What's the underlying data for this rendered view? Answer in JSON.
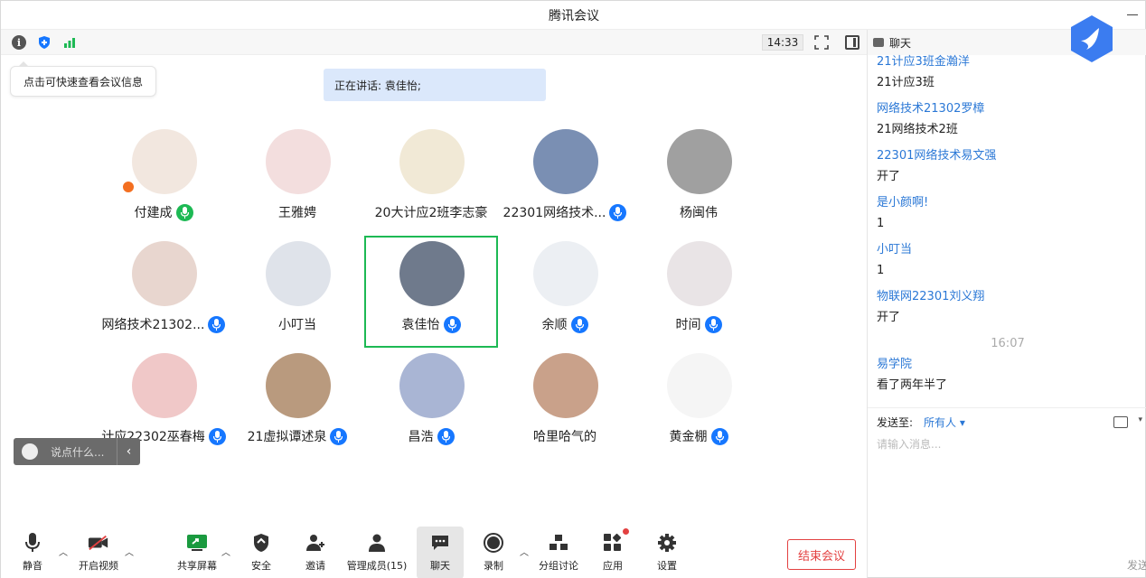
{
  "window": {
    "title": "腾讯会议"
  },
  "topbar": {
    "time": "14:33"
  },
  "tooltip": {
    "text": "点击可快速查看会议信息"
  },
  "speaking": {
    "text": "正在讲话: 袁佳怡;"
  },
  "participants": [
    {
      "name": "付建成",
      "mic": "green",
      "avatar_color": "#f2e7df"
    },
    {
      "name": "王雅娉",
      "mic": "none",
      "avatar_color": "#f3dede"
    },
    {
      "name": "20大计应2班李志豪",
      "mic": "none",
      "avatar_color": "#f1e9d6"
    },
    {
      "name": "22301网络技术...",
      "mic": "blue",
      "avatar_color": "#7a8fb3"
    },
    {
      "name": "杨闽伟",
      "mic": "none",
      "avatar_color": "#a0a0a0"
    },
    {
      "name": "网络技术21302...",
      "mic": "blue",
      "avatar_color": "#e8d6cf"
    },
    {
      "name": "小叮当",
      "mic": "none",
      "avatar_color": "#dfe3ea"
    },
    {
      "name": "袁佳怡",
      "mic": "blue",
      "avatar_color": "#6f7a8c"
    },
    {
      "name": "余顺",
      "mic": "blue",
      "avatar_color": "#eceff3"
    },
    {
      "name": "时间",
      "mic": "blue",
      "avatar_color": "#e9e4e6"
    },
    {
      "name": "计应22302巫春梅",
      "mic": "blue",
      "avatar_color": "#f0c8c8"
    },
    {
      "name": "21虚拟谭述泉",
      "mic": "blue",
      "avatar_color": "#b99a7e"
    },
    {
      "name": "昌浩",
      "mic": "blue",
      "avatar_color": "#a9b5d4"
    },
    {
      "name": "哈里哈气的",
      "mic": "none",
      "avatar_color": "#c9a18a"
    },
    {
      "name": "黄金棚",
      "mic": "blue",
      "avatar_color": "#f5f5f5"
    }
  ],
  "say_box": {
    "placeholder": "说点什么..."
  },
  "toolbar": {
    "mute": "静音",
    "video": "开启视频",
    "share": "共享屏幕",
    "security": "安全",
    "invite": "邀请",
    "members": "管理成员(15)",
    "chat": "聊天",
    "record": "录制",
    "breakout": "分组讨论",
    "apps": "应用",
    "settings": "设置",
    "end": "结束会议"
  },
  "chat": {
    "title": "聊天",
    "messages": [
      {
        "sender": "21计应3班金瀚洋",
        "text": "21计应3班"
      },
      {
        "sender": "网络技术21302罗樟",
        "text": "21网络技术2班"
      },
      {
        "sender": "22301网络技术易文强",
        "text": "开了"
      },
      {
        "sender": "是小颜啊!",
        "text": "1"
      },
      {
        "sender": "小叮当",
        "text": "1"
      },
      {
        "sender": "物联网22301刘义翔",
        "text": "开了"
      }
    ],
    "timestamp": "16:07",
    "messages2": [
      {
        "sender": "易学院",
        "text": "看了两年半了"
      }
    ],
    "send_to_label": "发送至:",
    "send_to_value": "所有人",
    "input_placeholder": "请输入消息...",
    "send_label": "发送"
  }
}
